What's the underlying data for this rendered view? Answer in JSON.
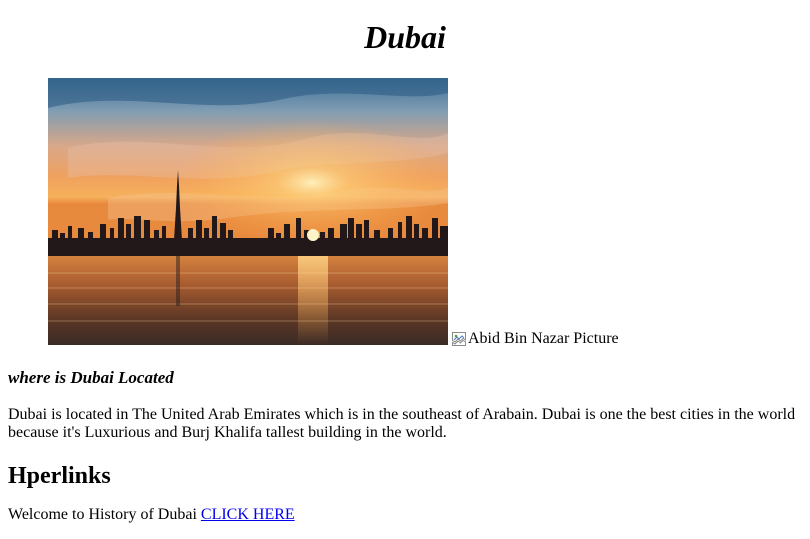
{
  "page": {
    "title": "Dubai",
    "image_alt": "Abid Bin Nazar Picture",
    "section_heading": "where is Dubai Located",
    "description": "Dubai is located in The United Arab Emirates which is in the southeast of Arabain. Dubai is one the best cities in the world because it's Luxurious and Burj Khalifa tallest building in the world.",
    "links_heading": "Hperlinks",
    "welcome_text": "Welcome to History of Dubai",
    "link_label": "CLICK HERE"
  },
  "colors": {
    "link": "#0000ee",
    "text": "#000000",
    "background": "#ffffff"
  },
  "icons": {
    "broken_image": "broken-image-icon"
  }
}
